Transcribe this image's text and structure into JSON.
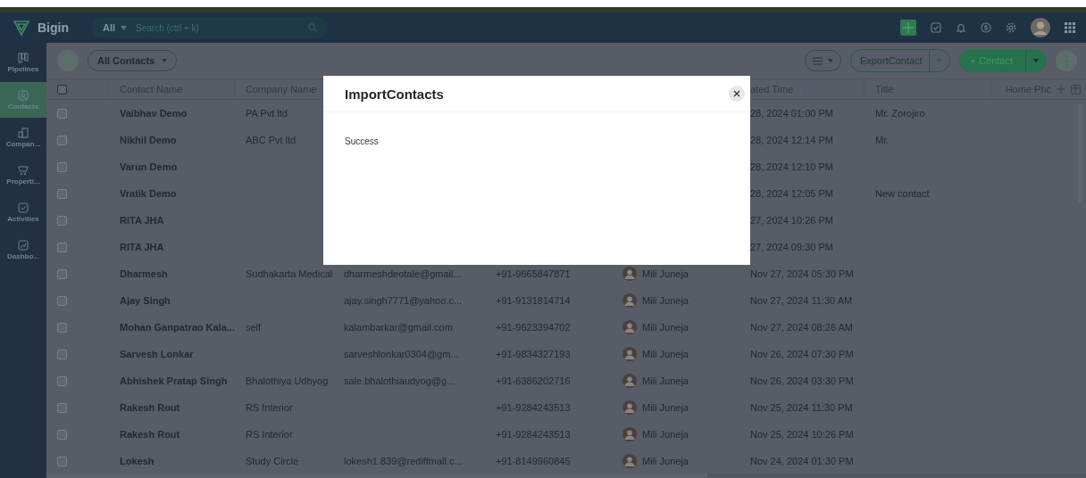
{
  "top_bar": {
    "app_name": "Bigin",
    "search": {
      "scope": "All",
      "placeholder": "Search (ctrl + k)"
    }
  },
  "sidebar": {
    "items": [
      {
        "label": "Pipelines",
        "selected": false
      },
      {
        "label": "Contacts",
        "selected": true
      },
      {
        "label": "Compan...",
        "selected": false
      },
      {
        "label": "Properti...",
        "selected": false
      },
      {
        "label": "Activities",
        "selected": false
      },
      {
        "label": "Dashbo...",
        "selected": false
      }
    ]
  },
  "toolbar": {
    "view": "All Contacts",
    "export_button": "ExportContact",
    "add_button": "+ Contact"
  },
  "table": {
    "header": {
      "checked": false,
      "name": "Contact Name",
      "company": "Company Name",
      "created": "ated Time",
      "sorted": true,
      "title": "Title",
      "home_phone": "Home Phc"
    },
    "rows": [
      {
        "checked": false,
        "name": "Vaibhav Demo",
        "company": "PA Pvt ltd",
        "created": "28, 2024 01:00 PM",
        "title": "Mr. Zorojiro"
      },
      {
        "checked": false,
        "name": "Nikhil Demo",
        "company": "ABC Pvt ltd",
        "created": "28, 2024 12:14 PM",
        "title": "Mr."
      },
      {
        "checked": false,
        "name": "Varun Demo",
        "created": "28, 2024 12:10 PM"
      },
      {
        "checked": false,
        "name": "Vratik Demo",
        "created": "28, 2024 12:05 PM",
        "title": "New contact"
      },
      {
        "checked": false,
        "name": "RITA JHA",
        "created": "27, 2024 10:26 PM"
      },
      {
        "checked": false,
        "name": "RITA JHA",
        "created": "27, 2024 09:30 PM"
      },
      {
        "checked": false,
        "name": "Dharmesh",
        "company": "Sudhakarta Medical",
        "email": "dharmeshdeotale@gmail...",
        "phone": "+91-9665847871",
        "owner": "Mili Juneja",
        "created": "Nov 27, 2024 05:30 PM"
      },
      {
        "checked": false,
        "name": "Ajay Singh",
        "email": "ajay.singh7771@yahoo.c...",
        "phone": "+91-9131814714",
        "owner": "Mili Juneja",
        "created": "Nov 27, 2024 11:30 AM"
      },
      {
        "checked": false,
        "name": "Mohan Ganpatrao Kala...",
        "company": "self",
        "email": "kalambarkar@gmail.com",
        "phone": "+91-9623394702",
        "owner": "Mili Juneja",
        "created": "Nov 27, 2024 08:26 AM"
      },
      {
        "checked": false,
        "name": "Sarvesh Lonkar",
        "email": "sarveshlonkar0304@gm...",
        "phone": "+91-9834327193",
        "owner": "Mili Juneja",
        "created": "Nov 26, 2024 07:30 PM"
      },
      {
        "checked": false,
        "name": "Abhishek Pratap Singh",
        "company": "Bhalothiya Udhyog",
        "email": "sale.bhalothiaudyog@g...",
        "phone": "+91-6386202716",
        "owner": "Mili Juneja",
        "created": "Nov 26, 2024 03:30 PM"
      },
      {
        "checked": false,
        "name": "Rakesh Rout",
        "company": "RS Interior",
        "phone": "+91-9284243513",
        "owner": "Mili Juneja",
        "created": "Nov 25, 2024 11:30 PM"
      },
      {
        "checked": false,
        "name": "Rakesh Rout",
        "company": "RS Interior",
        "phone": "+91-9284243513",
        "owner": "Mili Juneja",
        "created": "Nov 25, 2024 10:26 PM"
      },
      {
        "checked": false,
        "name": "Lokesh",
        "company": "Study Circle",
        "email": "lokesh1.839@rediffmail.c...",
        "phone": "+91-8149960845",
        "owner": "Mili Juneja",
        "created": "Nov 24, 2024 01:30 PM"
      }
    ]
  },
  "dialog": {
    "title": "ImportContacts",
    "message": "Success"
  }
}
